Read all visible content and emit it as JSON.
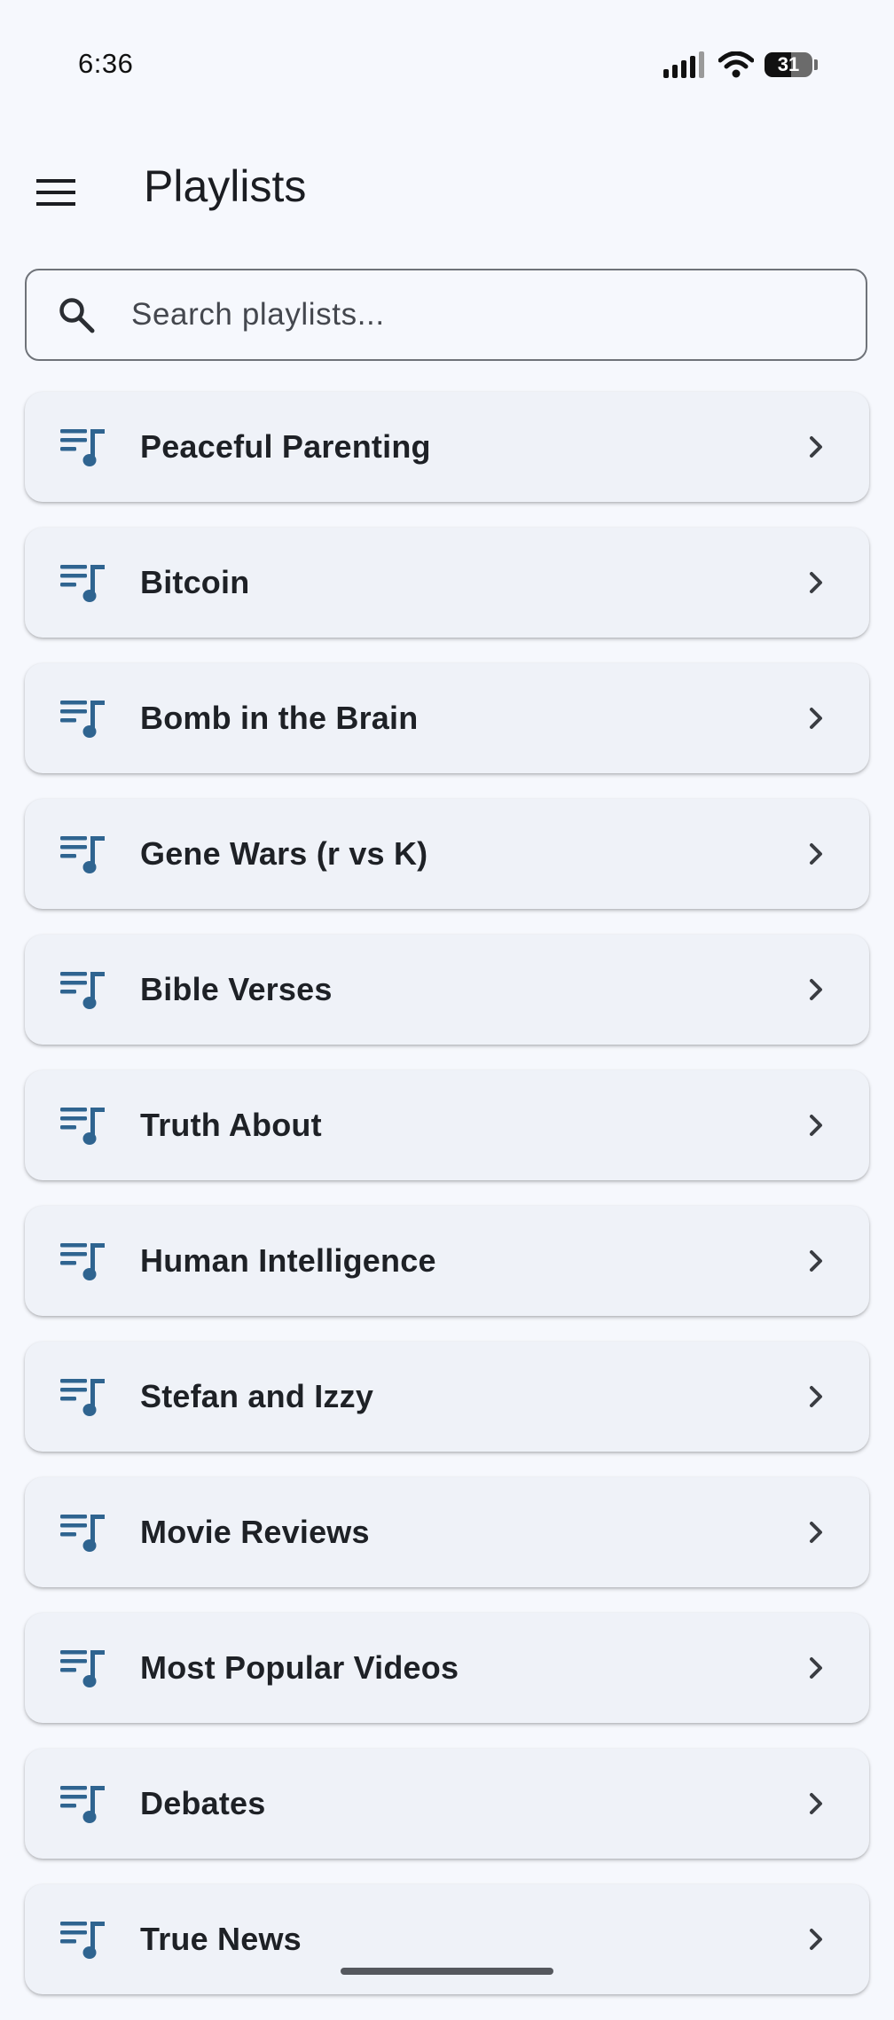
{
  "status_bar": {
    "time": "6:36",
    "battery": "31",
    "battery_level": 0.31
  },
  "app_bar": {
    "title": "Playlists",
    "menu_icon": "hamburger-menu-icon"
  },
  "search": {
    "placeholder": "Search playlists...",
    "value": "",
    "icon": "search-icon"
  },
  "playlists": [
    {
      "name": "Peaceful Parenting"
    },
    {
      "name": "Bitcoin"
    },
    {
      "name": "Bomb in the Brain"
    },
    {
      "name": "Gene Wars (r vs K)"
    },
    {
      "name": "Bible Verses"
    },
    {
      "name": "Truth About"
    },
    {
      "name": "Human Intelligence"
    },
    {
      "name": "Stefan and Izzy"
    },
    {
      "name": "Movie Reviews"
    },
    {
      "name": "Most Popular Videos"
    },
    {
      "name": "Debates"
    },
    {
      "name": "True News"
    }
  ],
  "colors": {
    "background": "#f6f8fd",
    "card": "#eff2f8",
    "accent": "#2f6490",
    "text": "#1b1d22"
  }
}
